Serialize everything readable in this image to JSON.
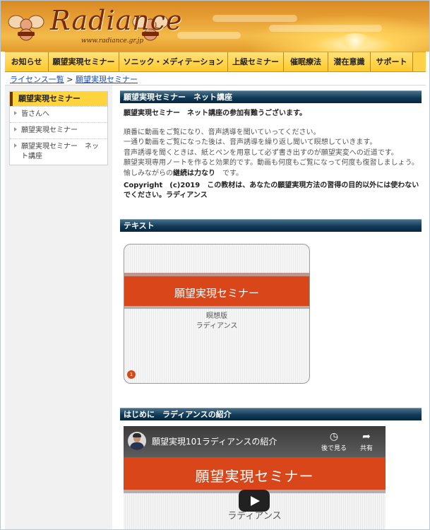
{
  "header": {
    "logo_text": "Radiance",
    "logo_url": "www.radiance.gr.jp"
  },
  "nav": {
    "items": [
      {
        "label": "お知らせ"
      },
      {
        "label": "願望実現セミナー"
      },
      {
        "label": "ソニック・メディテーション"
      },
      {
        "label": "上級セミナー"
      },
      {
        "label": "催眠療法"
      },
      {
        "label": "潜在意識"
      },
      {
        "label": "サポート"
      }
    ]
  },
  "breadcrumb": {
    "home": "ライセンス一覧",
    "sep": ">",
    "current": "願望実現セミナー"
  },
  "sidebar": {
    "title": "願望実現セミナー",
    "items": [
      {
        "label": "皆さんへ"
      },
      {
        "label": "願望実現セミナー"
      },
      {
        "label": "願望実現セミナー　ネット講座"
      }
    ]
  },
  "sections": {
    "course_title": "願望実現セミナー　ネット講座",
    "text_title": "テキスト",
    "intro_title": "はじめに　ラディアンスの紹介"
  },
  "intro": {
    "lead": "願望実現セミナー　ネット講座の参加有難うございます。",
    "lines": [
      "順番に動画をご覧になり、音声誘導を聞いていってください。",
      "一通り動画をご覧になった後は、音声誘導を繰り返し聞いて瞑想していきます。",
      "音声誘導を聞くときは、紙とペンを用意して必ず書き出すのが願望実変への近道です。",
      "願望実現専用ノートを作ると効果的です。動画も何度もご覧になって何度も復習しましょう。"
    ],
    "last_line_pre": "愉しみながらの",
    "last_line_bold": "継続は力なり",
    "last_line_post": "　です。",
    "copyright": "Copyright　(c)2019　この教材は、あなたの願望実現方法の習得の目的以外には使わないでください。ラディアンス"
  },
  "text_card": {
    "title": "願望実現セミナー",
    "sub1": "瞑想版",
    "sub2": "ラディアンス",
    "page_badge": "1"
  },
  "video": {
    "title": "願望実現101ラディアンスの紹介",
    "watch_later": "後で見る",
    "share": "共有",
    "band_title": "願望実現セミナー",
    "sub1": "瞑想",
    "sub2": "ラディアンス"
  },
  "colors": {
    "nav_bg": "#ffd24a",
    "section_bar": "#0f3a58",
    "band_orange": "#d8461a",
    "link": "#1a4fb3"
  }
}
